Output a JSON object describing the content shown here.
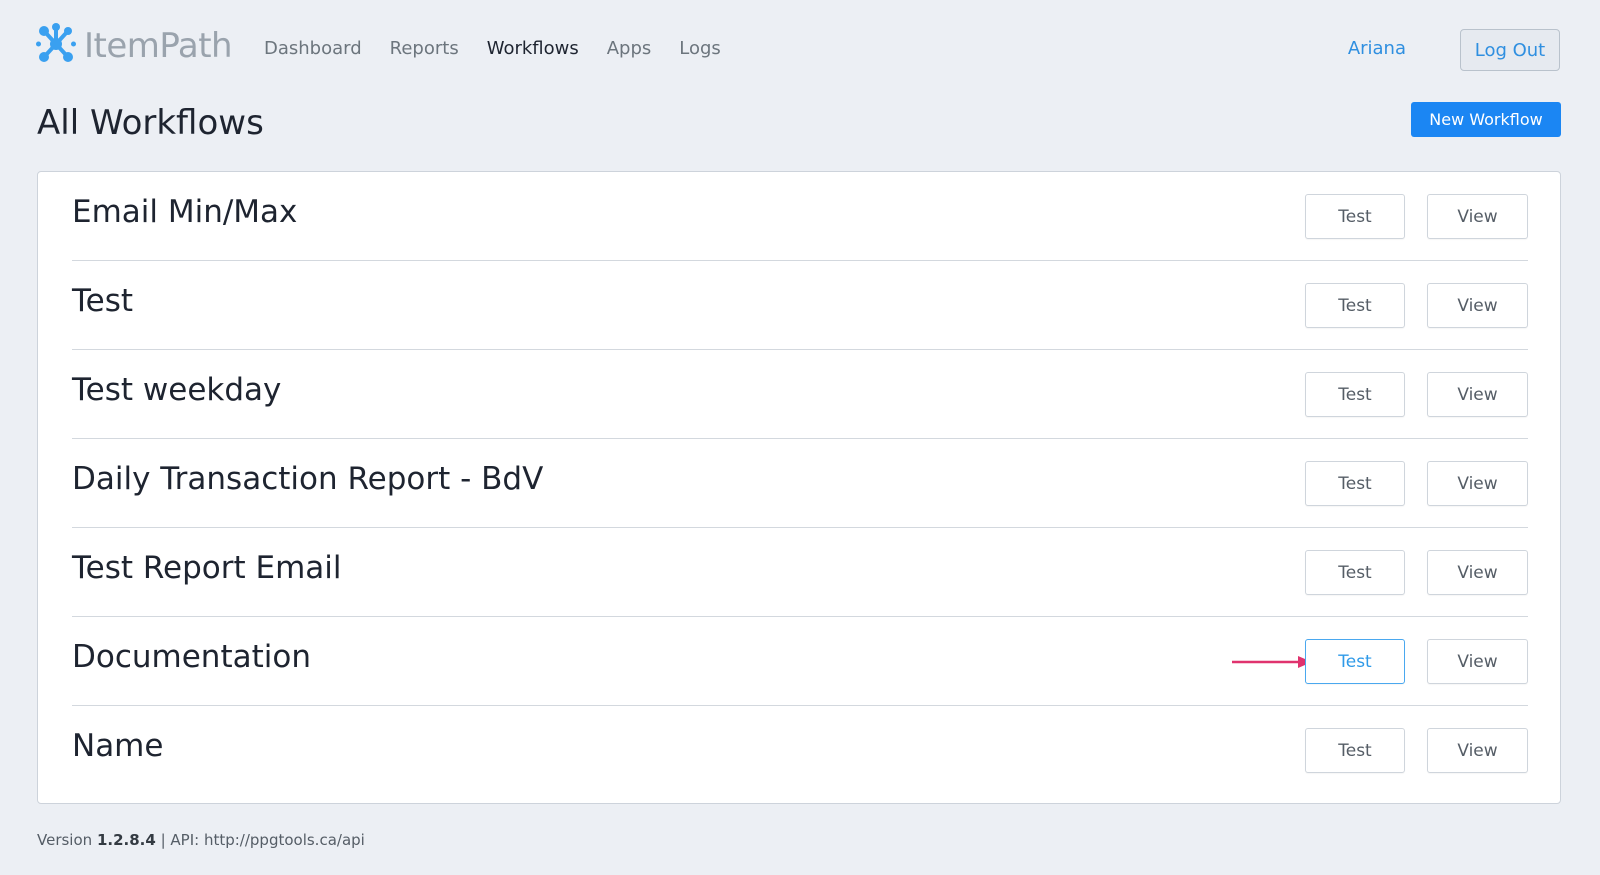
{
  "brand": {
    "name": "ItemPath",
    "logo_color": "#3aa0f0",
    "icon": "molecule-logo-icon"
  },
  "nav": {
    "items": [
      {
        "label": "Dashboard",
        "active": false
      },
      {
        "label": "Reports",
        "active": false
      },
      {
        "label": "Workflows",
        "active": true
      },
      {
        "label": "Apps",
        "active": false
      },
      {
        "label": "Logs",
        "active": false
      }
    ]
  },
  "user": {
    "name": "Ariana",
    "logout_label": "Log Out"
  },
  "page": {
    "title": "All Workflows",
    "new_button_label": "New Workflow"
  },
  "workflows": [
    {
      "name": "Email Min/Max",
      "test_label": "Test",
      "view_label": "View"
    },
    {
      "name": "Test",
      "test_label": "Test",
      "view_label": "View"
    },
    {
      "name": "Test weekday",
      "test_label": "Test",
      "view_label": "View"
    },
    {
      "name": "Daily Transaction Report - BdV",
      "test_label": "Test",
      "view_label": "View"
    },
    {
      "name": "Test Report Email",
      "test_label": "Test",
      "view_label": "View"
    },
    {
      "name": "Documentation",
      "test_label": "Test",
      "view_label": "View",
      "highlighted": true
    },
    {
      "name": "Name",
      "test_label": "Test",
      "view_label": "View"
    }
  ],
  "footer": {
    "version_prefix": "Version",
    "version": "1.2.8.4",
    "api_text": "| API: http://ppgtools.ca/api"
  },
  "colors": {
    "accent": "#1b86f3",
    "annotation_arrow": "#e0336e",
    "background": "#eceff4"
  }
}
